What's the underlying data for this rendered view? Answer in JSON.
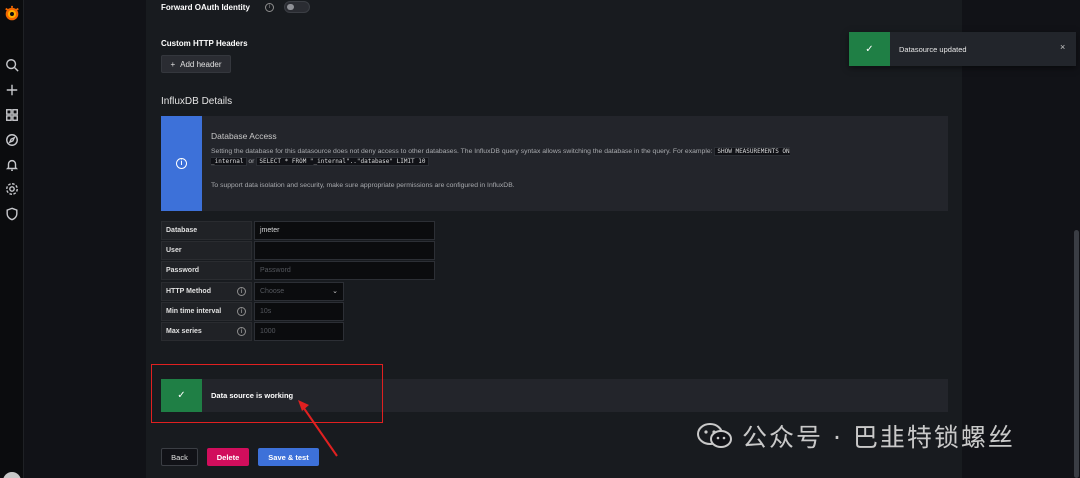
{
  "sidebar": {
    "icons": [
      "grafana-logo-icon",
      "search-icon",
      "plus-icon",
      "dashboards-icon",
      "explore-icon",
      "alerting-icon",
      "configuration-icon",
      "shield-icon",
      "user-avatar"
    ]
  },
  "auth": {
    "forward_oauth_label": "Forward OAuth Identity",
    "forward_oauth_enabled": false
  },
  "headers": {
    "title": "Custom HTTP Headers",
    "add_button": "Add header"
  },
  "influx": {
    "title": "InfluxDB Details",
    "alert": {
      "title": "Database Access",
      "text_prefix": "Setting the database for this datasource does not deny access to other databases. The InfluxDB query syntax allows switching the database in the query. For example:",
      "code1": "SHOW MEASUREMENTS ON _internal",
      "or": "or",
      "code2": "SELECT * FROM \"_internal\"..\"database\" LIMIT 10",
      "text2": "To support data isolation and security, make sure appropriate permissions are configured in InfluxDB."
    },
    "fields": {
      "database": {
        "label": "Database",
        "value": "jmeter"
      },
      "user": {
        "label": "User",
        "value": ""
      },
      "password": {
        "label": "Password",
        "placeholder": "Password"
      },
      "http_method": {
        "label": "HTTP Method",
        "placeholder": "Choose"
      },
      "min_interval": {
        "label": "Min time interval",
        "placeholder": "10s"
      },
      "max_series": {
        "label": "Max series",
        "placeholder": "1000"
      }
    }
  },
  "status": {
    "message": "Data source is working"
  },
  "actions": {
    "back": "Back",
    "delete": "Delete",
    "save": "Save & test"
  },
  "toast": {
    "message": "Datasource updated",
    "close": "×"
  },
  "watermark": {
    "text": "公众号 · 巴韭特锁螺丝"
  },
  "colors": {
    "primary": "#3d71d9",
    "success": "#1f7f45",
    "danger": "#d10e5c",
    "annotation": "#e02020"
  }
}
